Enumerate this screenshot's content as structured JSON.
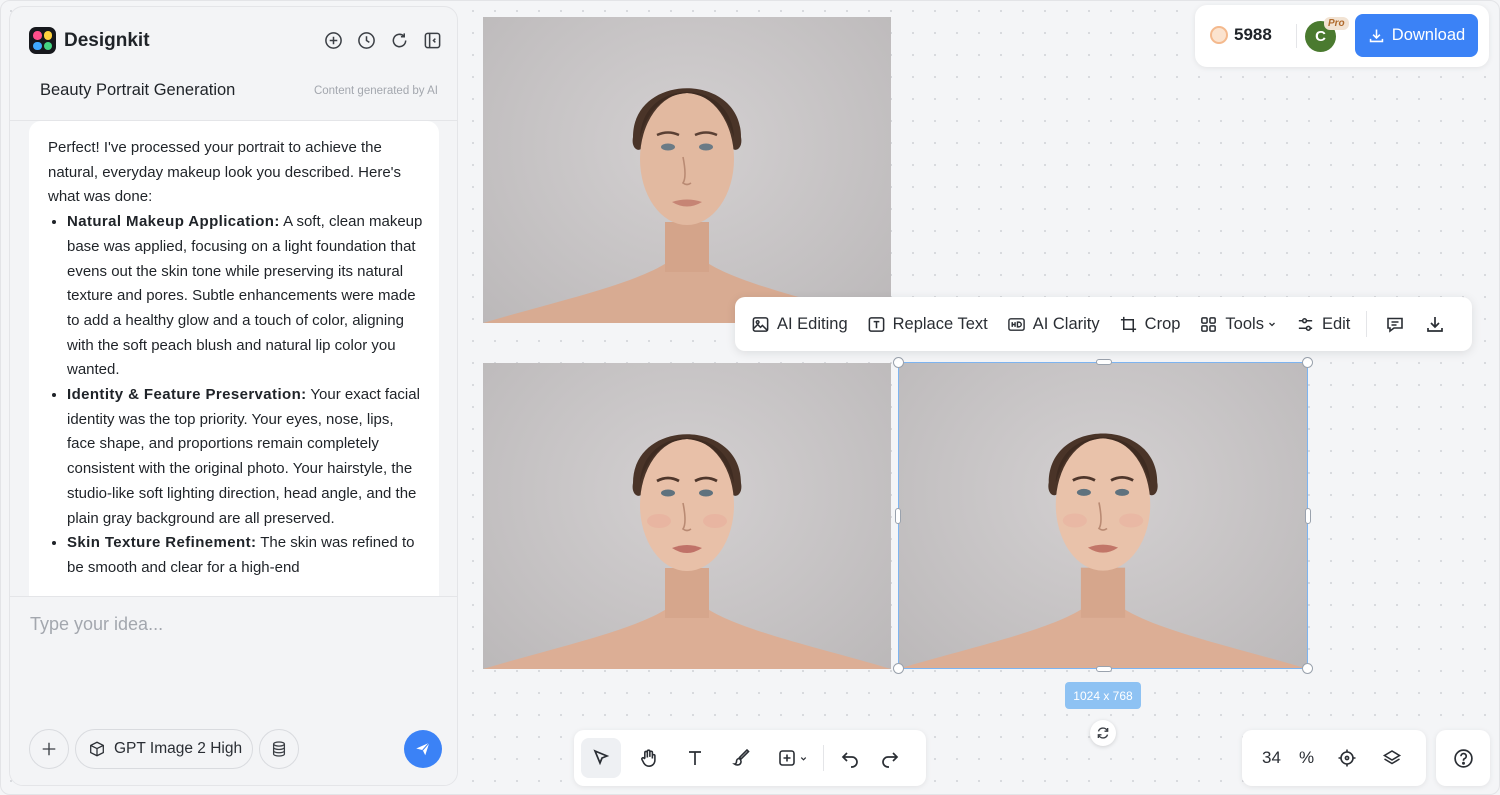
{
  "app": {
    "name": "Designkit"
  },
  "header": {
    "icons": [
      "new-chat-icon",
      "history-icon",
      "refresh-icon",
      "collapse-panel-icon"
    ]
  },
  "conversation": {
    "title": "Beauty Portrait Generation",
    "ai_note": "Content generated by AI",
    "message": {
      "intro": "Perfect! I've processed your portrait to achieve the natural, everyday makeup look you described. Here's what was done:",
      "points": [
        {
          "heading": "Natural Makeup Application:",
          "text": " A soft, clean makeup base was applied, focusing on a light foundation that evens out the skin tone while preserving its natural texture and pores. Subtle enhancements were made to add a healthy glow and a touch of color, aligning with the soft peach blush and natural lip color you wanted."
        },
        {
          "heading": "Identity & Feature Preservation:",
          "text": " Your exact facial identity was the top priority. Your eyes, nose, lips, face shape, and proportions remain completely consistent with the original photo. Your hairstyle, the studio-like soft lighting direction, head angle, and the plain gray background are all preserved."
        },
        {
          "heading": "Skin Texture Refinement:",
          "text": " The skin was refined to be smooth and clear for a high-end"
        }
      ]
    }
  },
  "composer": {
    "placeholder": "Type your idea...",
    "model_label": "GPT Image 2 High"
  },
  "topbar": {
    "credits": "5988",
    "avatar_initial": "C",
    "pro_badge": "Pro",
    "download_label": "Download"
  },
  "toolbar": {
    "ai_editing": "AI Editing",
    "replace_text": "Replace Text",
    "ai_clarity": "AI Clarity",
    "crop": "Crop",
    "tools": "Tools",
    "edit": "Edit"
  },
  "selection": {
    "size_label": "1024 x 768"
  },
  "zoom": {
    "value": "34",
    "unit": "%"
  },
  "colors": {
    "accent": "#3b82f6",
    "selection": "#7db4f0"
  }
}
